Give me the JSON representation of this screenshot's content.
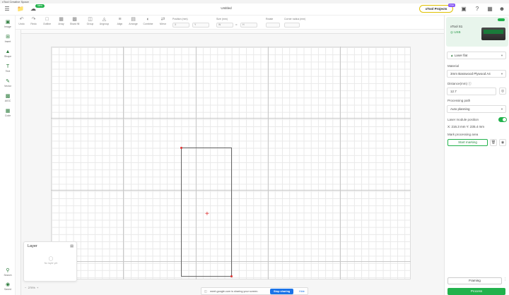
{
  "window": {
    "title": "xTool Creative Space"
  },
  "header": {
    "doc_title": "Untitled",
    "new_badge": "New",
    "projects_label": "xTool Projects",
    "projects_badge": "Free"
  },
  "toolbar": {
    "tools": [
      {
        "label": "Undo",
        "icon": "undo-icon"
      },
      {
        "label": "Redo",
        "icon": "redo-icon"
      },
      {
        "label": "Outline",
        "icon": "outline-icon"
      },
      {
        "label": "Array",
        "icon": "array-icon"
      },
      {
        "label": "Shard fill",
        "icon": "fill-icon"
      },
      {
        "label": "Group",
        "icon": "group-icon"
      },
      {
        "label": "Ungroup",
        "icon": "ungroup-icon"
      },
      {
        "label": "Align",
        "icon": "align-icon"
      },
      {
        "label": "Arrange",
        "icon": "arrange-icon"
      },
      {
        "label": "Combine",
        "icon": "combine-icon"
      },
      {
        "label": "Mirror",
        "icon": "mirror-icon"
      }
    ],
    "position_label": "Position (mm)",
    "position_x": "X",
    "position_y": "Y",
    "size_label": "Size (mm)",
    "size_w": "W",
    "size_h": "H",
    "rotate_label": "Rotate",
    "corner_label": "Corner radius (mm)"
  },
  "leftbar": {
    "tools": [
      {
        "label": "Image",
        "icon": "image-icon"
      },
      {
        "label": "Insert",
        "icon": "insert-icon"
      },
      {
        "label": "Shape",
        "icon": "shape-icon"
      },
      {
        "label": "Text",
        "icon": "text-icon"
      },
      {
        "label": "Vector",
        "icon": "pen-icon"
      },
      {
        "label": "AIGC",
        "icon": "aigc-icon"
      },
      {
        "label": "Code",
        "icon": "qrcode-icon"
      }
    ],
    "bottom": [
      {
        "label": "Search",
        "icon": "search-icon"
      },
      {
        "label": "Saved",
        "icon": "saved-icon"
      }
    ]
  },
  "layer_panel": {
    "title": "Layer",
    "empty_text": "No layer yet"
  },
  "zoom": {
    "value": "270%"
  },
  "sharebar": {
    "text": "meet.google.com is sharing your screen.",
    "stop_label": "Stop sharing",
    "hide_label": "Hide"
  },
  "right_panel": {
    "device_name": "xTool S1",
    "device_conn": "USB",
    "laser_select": "Laser flat",
    "material_label": "Material",
    "material_value": "3mm Basswood Plywood A4",
    "distance_label": "Distance(mm)",
    "distance_value": "12.7",
    "processing_path_label": "Processing path",
    "processing_path_value": "Auto planning",
    "laser_module_label": "Laser module position",
    "coords": "X: 216.3 mm  Y: 235.4 mm",
    "mark_area_label": "Mark processing area",
    "start_marking": "Start marking",
    "framing": "Framing",
    "process": "Process"
  },
  "colors": {
    "accent": "#22b24c",
    "marker": "#e03030",
    "share_blue": "#1a73e8"
  }
}
